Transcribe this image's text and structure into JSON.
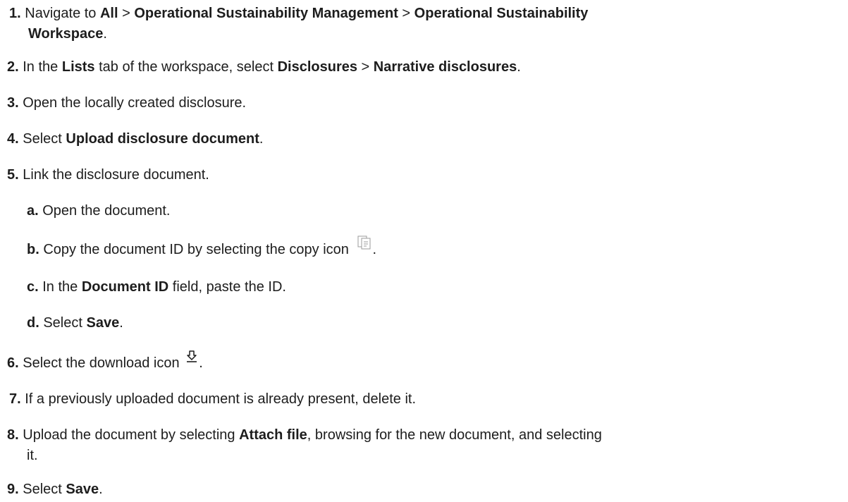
{
  "steps": [
    {
      "num": "1.",
      "text1": "Navigate to ",
      "b1": "All",
      "text2": " > ",
      "b2": "Operational Sustainability Management",
      "text3": " > ",
      "b3": "Operational Sustainability",
      "b3b": "Workspace",
      "text4": "."
    },
    {
      "num": "2.",
      "text1": "In the ",
      "b1": "Lists",
      "text2": " tab of the workspace, select ",
      "b2": "Disclosures",
      "text3": " > ",
      "b3": "Narrative disclosures",
      "text4": "."
    },
    {
      "num": "3.",
      "text1": "Open the locally created disclosure."
    },
    {
      "num": "4.",
      "text1": "Select ",
      "b1": "Upload disclosure document",
      "text2": "."
    },
    {
      "num": "5.",
      "text1": "Link the disclosure document.",
      "sub": [
        {
          "num": "a.",
          "text1": "Open the document."
        },
        {
          "num": "b.",
          "text1": "Copy the document ID by selecting the copy icon ",
          "text2": ".",
          "icon": "copy-icon"
        },
        {
          "num": "c.",
          "text1": "In the ",
          "b1": "Document ID",
          "text2": " field, paste the ID."
        },
        {
          "num": "d.",
          "text1": "Select ",
          "b1": "Save",
          "text2": "."
        }
      ]
    },
    {
      "num": "6.",
      "text1": "Select the download icon ",
      "text2": ".",
      "icon": "download-icon"
    },
    {
      "num": "7.",
      "text1": "If a previously uploaded document is already present, delete it."
    },
    {
      "num": "8.",
      "text1": "Upload the document by selecting ",
      "b1": "Attach file",
      "text2": ", browsing for the new document, and selecting",
      "text3": "it."
    },
    {
      "num": "9.",
      "text1": "Select ",
      "b1": "Save",
      "text2": "."
    }
  ]
}
